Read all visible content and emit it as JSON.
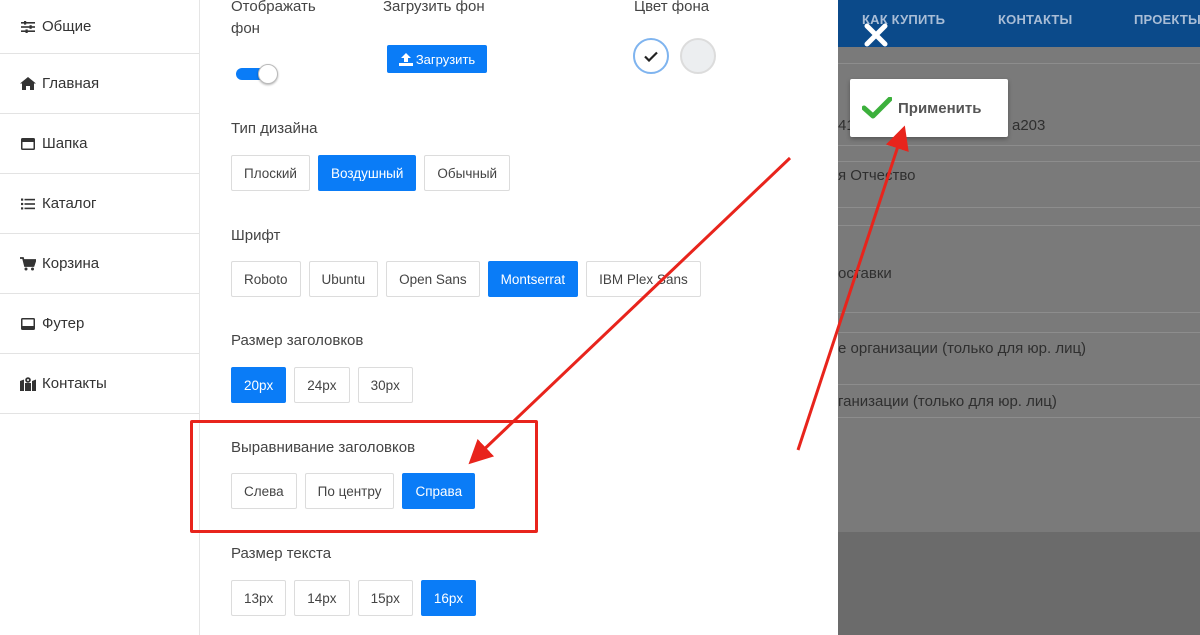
{
  "sidebar": {
    "items": [
      {
        "label": "Общие",
        "icon": "sliders-icon"
      },
      {
        "label": "Главная",
        "icon": "home-icon"
      },
      {
        "label": "Шапка",
        "icon": "header-icon"
      },
      {
        "label": "Каталог",
        "icon": "list-icon"
      },
      {
        "label": "Корзина",
        "icon": "cart-icon"
      },
      {
        "label": "Футер",
        "icon": "footer-icon"
      },
      {
        "label": "Контакты",
        "icon": "map-icon"
      }
    ]
  },
  "settings": {
    "show_bg_label_line1": "Отображать",
    "show_bg_label_line2": "фон",
    "show_bg_on": true,
    "upload_bg_label": "Загрузить фон",
    "upload_button": "Загрузить",
    "bg_color_label": "Цвет фона",
    "bg_colors": [
      "#ffffff",
      "#eceef0"
    ],
    "design_label": "Тип дизайна",
    "design_options": [
      "Плоский",
      "Воздушный",
      "Обычный"
    ],
    "design_selected": "Воздушный",
    "font_label": "Шрифт",
    "font_options": [
      "Roboto",
      "Ubuntu",
      "Open Sans",
      "Montserrat",
      "IBM Plex Sans"
    ],
    "font_selected": "Montserrat",
    "heading_size_label": "Размер заголовков",
    "heading_size_options": [
      "20px",
      "24px",
      "30px"
    ],
    "heading_size_selected": "20px",
    "heading_align_label": "Выравнивание заголовков",
    "heading_align_options": [
      "Слева",
      "По центру",
      "Справа"
    ],
    "heading_align_selected": "Справа",
    "text_size_label": "Размер текста",
    "text_size_options": [
      "13px",
      "14px",
      "15px",
      "16px"
    ],
    "text_size_selected": "16px"
  },
  "background_page": {
    "nav": [
      "КАК КУПИТЬ",
      "КОНТАКТЫ",
      "ПРОЕКТЫ"
    ],
    "form_fragments": [
      "41",
      "a203",
      "я Отчество",
      "оставки",
      "е организации (только для юр. лиц)",
      "ганизации (только для юр. лиц)"
    ]
  },
  "apply_button": "Применить",
  "accent_color": "#0a7cf7",
  "annotation_color": "#e8241c"
}
